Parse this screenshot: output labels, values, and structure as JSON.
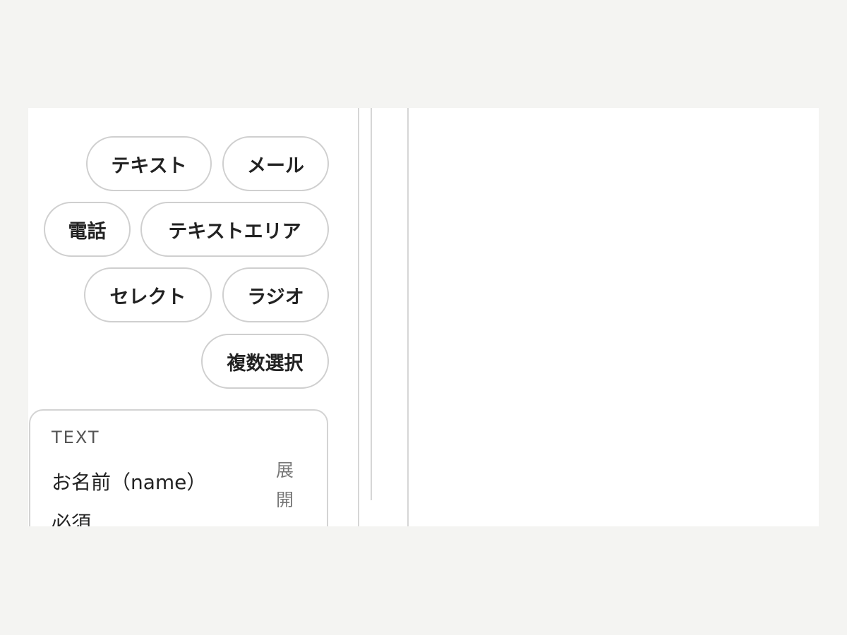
{
  "field_types": [
    {
      "key": "text",
      "label": "テキスト"
    },
    {
      "key": "email",
      "label": "メール"
    },
    {
      "key": "tel",
      "label": "電話"
    },
    {
      "key": "textarea",
      "label": "テキストエリア"
    },
    {
      "key": "select",
      "label": "セレクト"
    },
    {
      "key": "radio",
      "label": "ラジオ"
    },
    {
      "key": "checkbox",
      "label": "複数選択"
    }
  ],
  "field_card": {
    "type_label": "TEXT",
    "name": "お名前（name）",
    "required": "必須",
    "expand_label": "展開"
  }
}
